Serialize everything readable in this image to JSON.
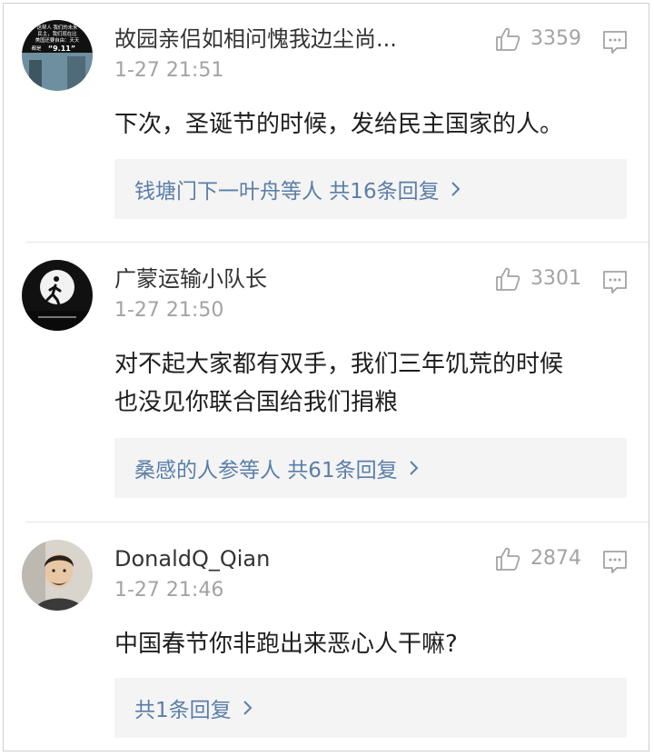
{
  "comments": [
    {
      "user": "故园亲侣如相问愧我边尘尚...",
      "time": "1-27 21:51",
      "likes": "3359",
      "text_lines": [
        "下次，圣诞节的时候，发给民主国家的人。"
      ],
      "replies_label": "钱塘门下一叶舟等人 共16条回复",
      "avatar_icon": "poster-avatar-icon",
      "avatar_text": [
        "这帮人 我们的未来",
        "民主，我们现在比",
        "美国还要自由：天天",
        "都是",
        "“9.11”"
      ]
    },
    {
      "user": "广蒙运输小队长",
      "time": "1-27 21:50",
      "likes": "3301",
      "text_lines": [
        "对不起大家都有双手，我们三年饥荒的时候",
        "也没见你联合国给我们捐粮"
      ],
      "replies_label": "桑感的人参等人 共61条回复",
      "avatar_icon": "runner-moon-avatar-icon"
    },
    {
      "user": "DonaldQ_Qian",
      "time": "1-27 21:46",
      "likes": "2874",
      "text_lines": [
        "中国春节你非跑出来恶心人干嘛?"
      ],
      "replies_label": "共1条回复",
      "avatar_icon": "person-photo-avatar-icon"
    }
  ],
  "icons": {
    "like": "thumbs-up-icon",
    "reply": "comment-icon",
    "chevron": "chevron-right-icon"
  },
  "colors": {
    "link": "#5a7ea8",
    "meta": "#a3a3a3",
    "reply_bg": "#f4f4f4"
  }
}
